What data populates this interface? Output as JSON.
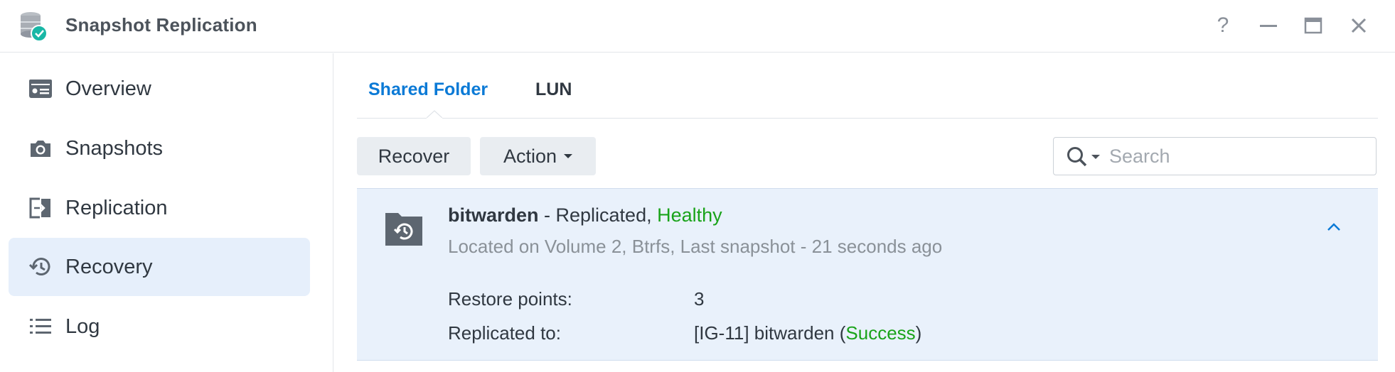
{
  "window": {
    "title": "Snapshot Replication",
    "controls": {
      "help": "?"
    }
  },
  "sidebar": {
    "items": [
      {
        "label": "Overview",
        "icon": "overview-icon"
      },
      {
        "label": "Snapshots",
        "icon": "camera-icon"
      },
      {
        "label": "Replication",
        "icon": "replication-icon"
      },
      {
        "label": "Recovery",
        "icon": "recovery-icon",
        "active": true
      },
      {
        "label": "Log",
        "icon": "list-icon"
      }
    ]
  },
  "tabs": [
    {
      "label": "Shared Folder",
      "active": true
    },
    {
      "label": "LUN"
    }
  ],
  "toolbar": {
    "recover_label": "Recover",
    "action_label": "Action"
  },
  "search": {
    "placeholder": "Search",
    "value": ""
  },
  "item": {
    "name": "bitwarden",
    "separator": " - Replicated, ",
    "status": "Healthy",
    "location": "Located on Volume 2, Btrfs, Last snapshot - 21 seconds ago",
    "restore_points_label": "Restore points:",
    "restore_points_value": "3",
    "replicated_to_label": "Replicated to:",
    "replicated_to_value": "[IG-11] bitwarden (",
    "replicated_to_status": "Success",
    "replicated_to_close": ")"
  },
  "colors": {
    "accent": "#0b7ad6",
    "success": "#1aa31a",
    "active_bg": "#e6effb",
    "card_bg": "#e9f1fb"
  }
}
